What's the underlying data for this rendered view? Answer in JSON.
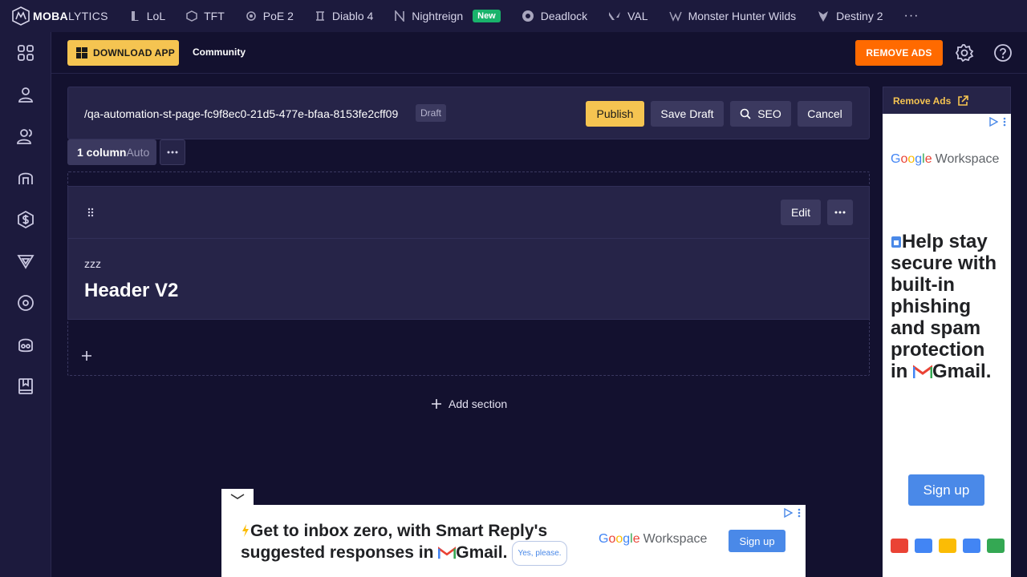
{
  "topnav": {
    "logo_bold": "MOBA",
    "logo_thin": "LYTICS",
    "games": [
      {
        "label": "LoL",
        "icon": "lol-icon"
      },
      {
        "label": "TFT",
        "icon": "tft-icon"
      },
      {
        "label": "PoE 2",
        "icon": "poe2-icon"
      },
      {
        "label": "Diablo 4",
        "icon": "diablo4-icon"
      },
      {
        "label": "Nightreign",
        "icon": "nightreign-icon",
        "badge": "New"
      },
      {
        "label": "Deadlock",
        "icon": "deadlock-icon"
      },
      {
        "label": "VAL",
        "icon": "valorant-icon"
      },
      {
        "label": "Monster Hunter Wilds",
        "icon": "mhw-icon"
      },
      {
        "label": "Destiny 2",
        "icon": "destiny2-icon"
      }
    ],
    "more": "···"
  },
  "header": {
    "download_label": "DOWNLOAD APP",
    "community_label": "Community",
    "remove_ads_label": "REMOVE ADS"
  },
  "editor": {
    "slug": "/qa-automation-st-page-fc9f8ec0-21d5-477e-bfaa-8153fe2cff09",
    "status": "Draft",
    "publish_label": "Publish",
    "save_draft_label": "Save Draft",
    "seo_label": "SEO",
    "cancel_label": "Cancel",
    "columns_label": "1 column",
    "columns_mode": "Auto",
    "block": {
      "edit_label": "Edit",
      "kicker": "zzz",
      "title": "Header V2"
    },
    "add_section_label": "Add section"
  },
  "ads": {
    "side": {
      "remove_ads_label": "Remove Ads",
      "brand_g": [
        "G",
        "o",
        "o",
        "g",
        "l",
        "e"
      ],
      "brand_suffix": "Workspace",
      "headline_parts": [
        "Help stay secure with built-in phishing and spam protection in",
        "Gmail."
      ],
      "cta": "Sign up"
    },
    "bottom": {
      "headline_parts": [
        "Get to inbox zero, with Smart Reply's suggested responses in",
        "Gmail."
      ],
      "chip": "Yes, please.",
      "brand_suffix": "Workspace",
      "cta": "Sign up"
    }
  },
  "colors": {
    "accent_yellow": "#f5c451",
    "accent_orange": "#ff6a00",
    "bg": "#13112f",
    "panel": "#262448"
  }
}
